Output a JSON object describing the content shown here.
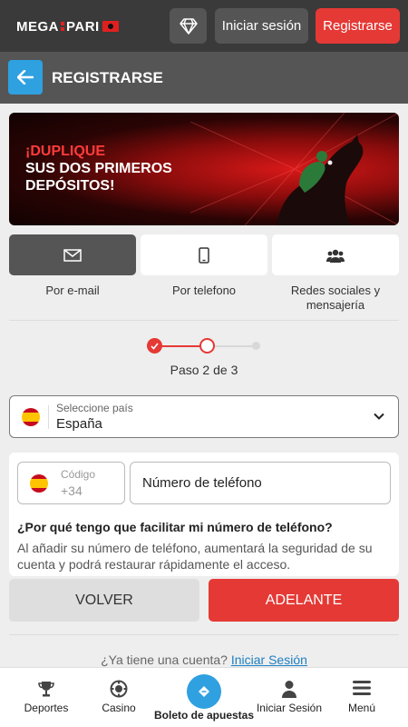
{
  "header": {
    "logo_text": "MEGA PARI",
    "login_label": "Iniciar sesión",
    "register_label": "Registrarse",
    "diamond_icon": "diamond-icon"
  },
  "titlebar": {
    "title": "REGISTRARSE",
    "back_icon": "arrow-left-icon"
  },
  "banner": {
    "line1": "¡DUPLIQUE",
    "line2": "SUS DOS PRIMEROS",
    "line3": "DEPÓSITOS!"
  },
  "tabs": [
    {
      "label": "Por e-mail",
      "icon": "envelope-icon",
      "active": true
    },
    {
      "label": "Por telefono",
      "icon": "phone-icon",
      "active": false
    },
    {
      "label": "Redes sociales y mensajería",
      "icon": "users-icon",
      "active": false
    }
  ],
  "stepper": {
    "text": "Paso 2 de 3",
    "current": 2,
    "total": 3
  },
  "country": {
    "label": "Seleccione país",
    "value": "España"
  },
  "phone": {
    "code_label": "Código",
    "code_value": "+34",
    "placeholder": "Número de teléfono",
    "why_title": "¿Por qué tengo que facilitar mi número de teléfono?",
    "why_text": "Al añadir su número de teléfono, aumentará la seguridad de su cuenta y podrá restaurar rápidamente el acceso."
  },
  "actions": {
    "back_label": "VOLVER",
    "next_label": "ADELANTE"
  },
  "footer": {
    "question": "¿Ya tiene una cuenta?",
    "login_link": "Iniciar Sesión"
  },
  "bottom_nav": [
    {
      "label": "Deportes",
      "icon": "trophy-icon"
    },
    {
      "label": "Casino",
      "icon": "casino-chip-icon"
    },
    {
      "label": "Boleto de apuestas",
      "icon": "ticket-icon"
    },
    {
      "label": "Iniciar Sesión",
      "icon": "user-icon"
    },
    {
      "label": "Menú",
      "icon": "hamburger-icon"
    }
  ],
  "colors": {
    "accent_red": "#e53935",
    "accent_blue": "#2fa0e0",
    "header_bg": "#3a3a3a",
    "titlebar_bg": "#555555"
  }
}
